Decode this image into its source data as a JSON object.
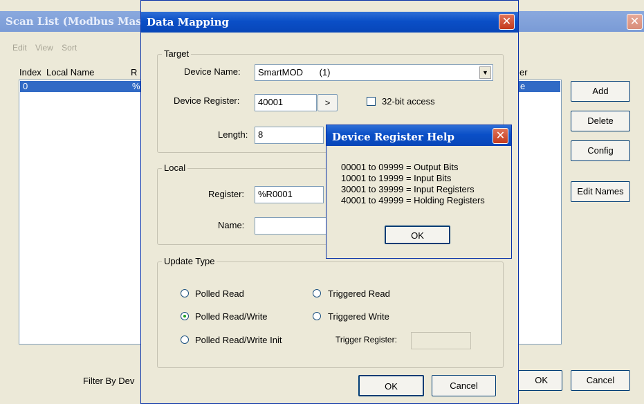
{
  "scan_list": {
    "title": "Scan List (Modbus Mas",
    "close_glyph": "✕",
    "menu": [
      "Edit",
      "View",
      "Sort"
    ],
    "columns": {
      "index": "Index",
      "local_name": "Local Name",
      "r": "R",
      "er": "er"
    },
    "rows": [
      {
        "index": "0",
        "r": "%",
        "er": "e"
      }
    ],
    "buttons": {
      "add": "Add",
      "delete": "Delete",
      "config": "Config",
      "edit_names": "Edit Names",
      "ok": "OK",
      "cancel": "Cancel"
    },
    "filter_label": "Filter By Dev"
  },
  "data_mapping": {
    "title": "Data Mapping",
    "close_glyph": "✕",
    "target": {
      "label": "Target",
      "device_name_label": "Device Name:",
      "device_name_value": "SmartMOD",
      "device_name_id": "(1)",
      "device_register_label": "Device Register:",
      "device_register_value": "40001",
      "device_register_button": ">",
      "access_32bit_label": "32-bit access",
      "access_32bit_checked": false,
      "length_label": "Length:",
      "length_value": "8"
    },
    "local": {
      "label": "Local",
      "register_label": "Register:",
      "register_value": "%R0001",
      "name_label": "Name:",
      "name_value": ""
    },
    "update_type": {
      "label": "Update Type",
      "options": [
        {
          "label": "Polled Read",
          "selected": false
        },
        {
          "label": "Polled Read/Write",
          "selected": true
        },
        {
          "label": "Polled Read/Write Init",
          "selected": false
        },
        {
          "label": "Triggered Read",
          "selected": false
        },
        {
          "label": "Triggered Write",
          "selected": false
        }
      ],
      "trigger_register_label": "Trigger Register:",
      "trigger_register_value": ""
    },
    "buttons": {
      "ok": "OK",
      "cancel": "Cancel"
    }
  },
  "help_dialog": {
    "title": "Device Register Help",
    "close_glyph": "✕",
    "lines": [
      "00001 to 09999 = Output Bits",
      "10001 to 19999 = Input Bits",
      "30001 to 39999 = Input Registers",
      "40001 to 49999 = Holding Registers"
    ],
    "ok": "OK"
  },
  "colors": {
    "active_title": "#0a4fc7",
    "inactive_title": "#7a9bd6",
    "dialog_face": "#ece9d8",
    "selection": "#316ac5"
  }
}
